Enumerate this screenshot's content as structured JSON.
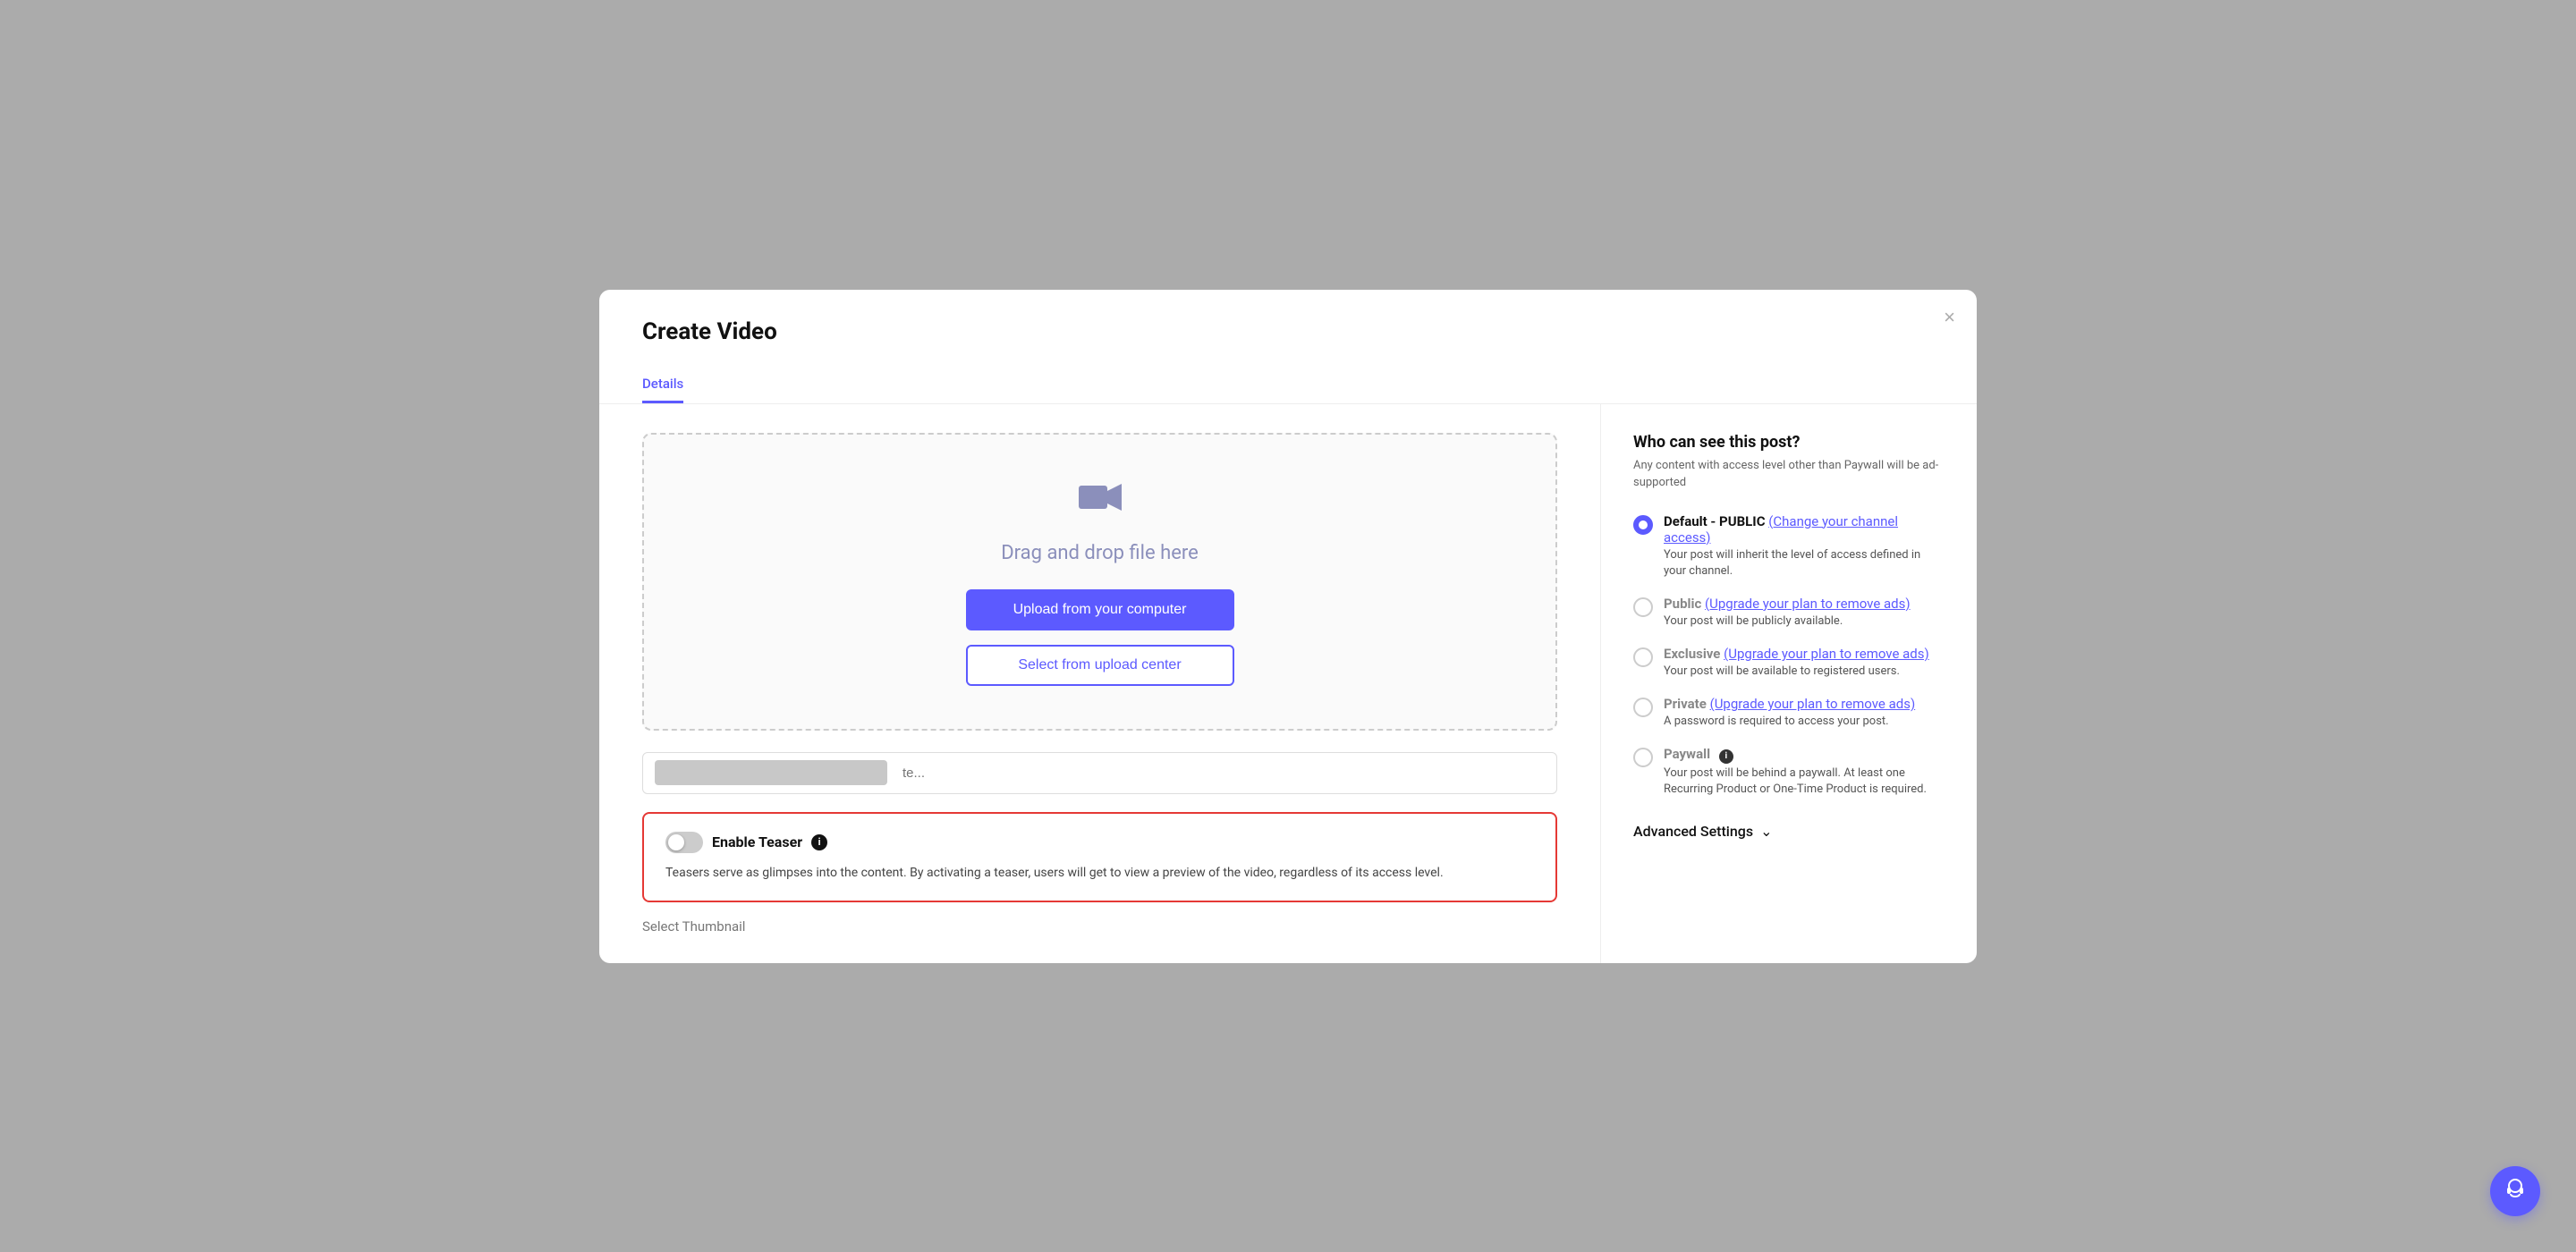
{
  "modal": {
    "title": "Create Video",
    "close_label": "×",
    "tab_details": "Details"
  },
  "upload_area": {
    "drag_text": "Drag and drop file here",
    "btn_primary": "Upload from your computer",
    "btn_secondary": "Select from upload center"
  },
  "title_input": {
    "placeholder": "te..."
  },
  "teaser": {
    "label": "Enable Teaser",
    "info": "i",
    "description": "Teasers serve as glimpses into the content. By activating a teaser, users will get to view a preview of the video, regardless of its access level."
  },
  "thumbnail_label": "Select Thumbnail",
  "sidebar": {
    "title": "Who can see this post?",
    "subtitle": "Any content with access level other than Paywall will be ad-supported",
    "options": [
      {
        "id": "default",
        "name": "Default - PUBLIC",
        "link_text": "(Change your channel access)",
        "description": "Your post will inherit the level of access defined in your channel.",
        "selected": true
      },
      {
        "id": "public",
        "name": "Public",
        "link_text": "(Upgrade your plan to remove ads)",
        "description": "Your post will be publicly available.",
        "selected": false
      },
      {
        "id": "exclusive",
        "name": "Exclusive",
        "link_text": "(Upgrade your plan to remove ads)",
        "description": "Your post will be available to registered users.",
        "selected": false
      },
      {
        "id": "private",
        "name": "Private",
        "link_text": "(Upgrade your plan to remove ads)",
        "description": "A password is required to access your post.",
        "selected": false
      },
      {
        "id": "paywall",
        "name": "Paywall",
        "info": "i",
        "description": "Your post will be behind a paywall. At least one Recurring Product or One-Time Product is required.",
        "selected": false
      }
    ],
    "advanced_settings": "Advanced Settings"
  },
  "support_icon": "headset"
}
